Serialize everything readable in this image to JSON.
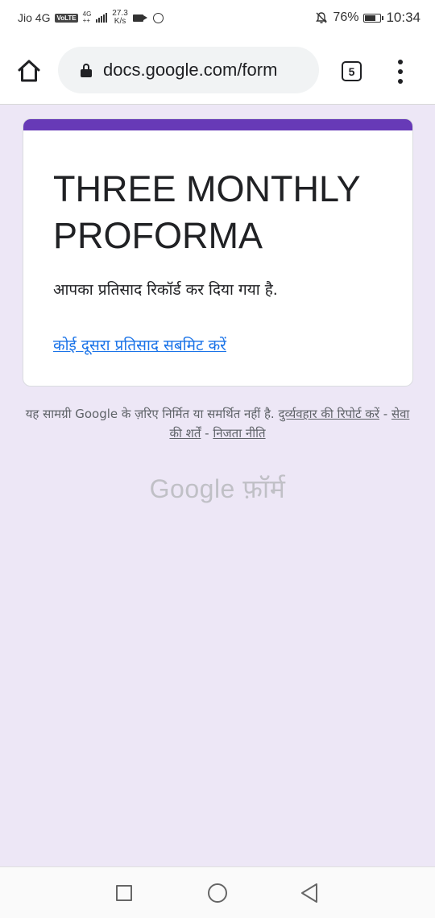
{
  "status_bar": {
    "carrier": "Jio 4G",
    "volte": "VoLTE",
    "network_type": "4G",
    "network_sub": "++",
    "speed_value": "27.3",
    "speed_unit": "K/s",
    "battery_percent": "76%",
    "battery_level": 0.76,
    "time": "10:34"
  },
  "browser": {
    "url": "docs.google.com/form",
    "tab_count": "5"
  },
  "form": {
    "accent_color": "#673ab7",
    "title": "THREE MONTHLY PROFORMA",
    "response_message": "आपका प्रतिसाद रिकॉर्ड कर दिया गया है.",
    "submit_another_link": "कोई दूसरा प्रतिसाद सबमिट करें"
  },
  "footer": {
    "disclaimer": "यह सामग्री Google के ज़रिए निर्मित या समर्थित नहीं है.",
    "report_abuse": "दुर्व्यवहार की रिपोर्ट करें",
    "sep1": " - ",
    "terms": "सेवा की शर्तें",
    "sep2": " - ",
    "privacy": "निजता नीति",
    "brand": "Google फ़ॉर्म"
  }
}
